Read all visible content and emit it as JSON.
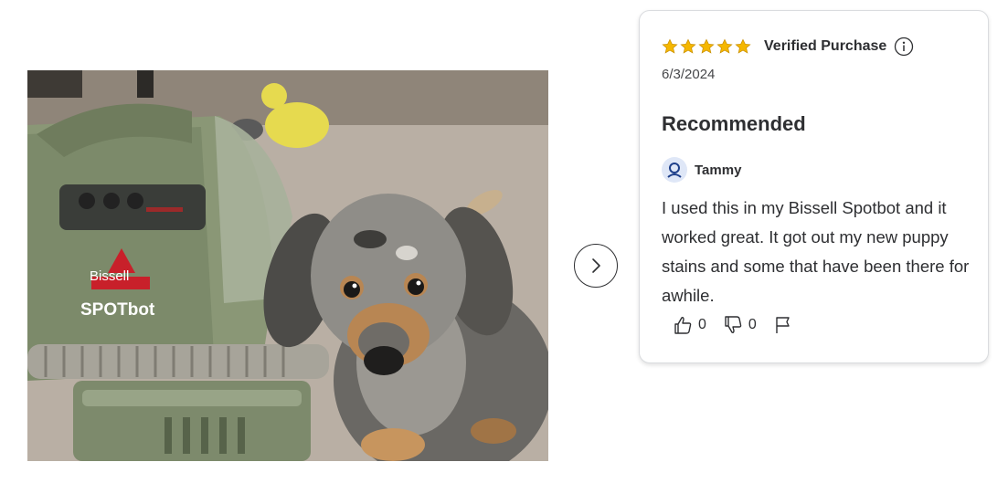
{
  "photo": {
    "alt": "Review photo: dachshund puppy sitting next to a Bissell Spotbot cleaner",
    "brand_text": "Bissell",
    "product_text": "SPOTbot"
  },
  "carousel": {
    "next_icon": "chevron-right-icon"
  },
  "review": {
    "rating": 5,
    "rating_max": 5,
    "star_color": "#f5b700",
    "verified_label": "Verified Purchase",
    "date": "6/3/2024",
    "headline": "Recommended",
    "author": "Tammy",
    "text": "I used this in my Bissell Spotbot and it worked great. It got out my new puppy stains and some that have been there for awhile.",
    "helpful_count": "0",
    "unhelpful_count": "0"
  }
}
